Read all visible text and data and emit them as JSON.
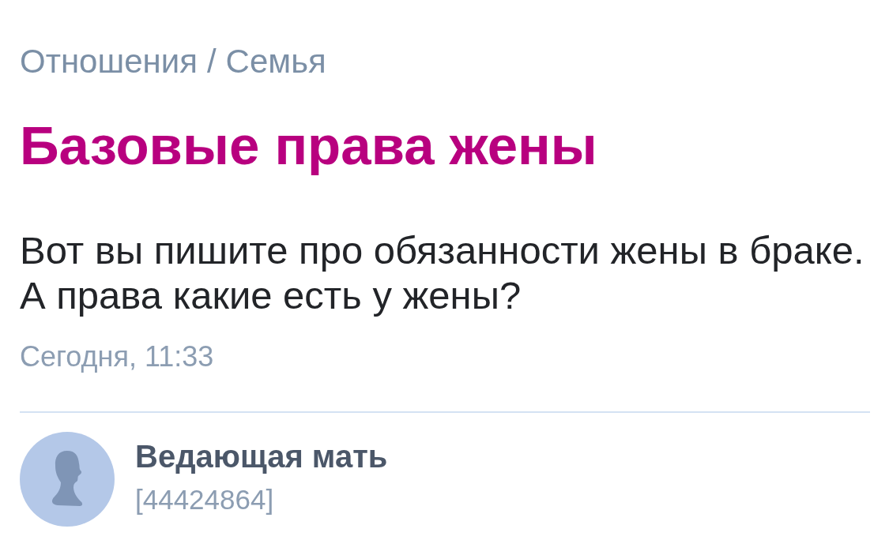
{
  "breadcrumbs": {
    "items": [
      "Отношения",
      "Семья"
    ],
    "separator": "/"
  },
  "post": {
    "title": "Базовые права жены",
    "body": "Вот вы пишите про обязанности жены в браке. А права какие есть у жены?",
    "time": "Сегодня, 11:33"
  },
  "author": {
    "name": "Ведающая мать",
    "id": "[44424864]"
  }
}
